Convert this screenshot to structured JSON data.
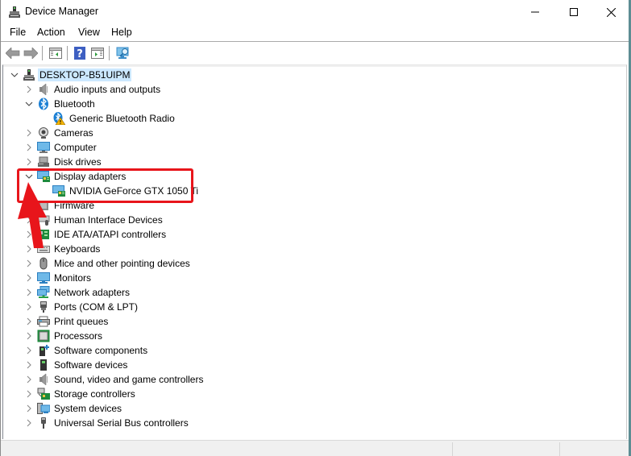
{
  "window": {
    "title": "Device Manager",
    "controls": {
      "minimize": "minimize",
      "maximize": "maximize",
      "close": "close"
    }
  },
  "menubar": {
    "items": [
      "File",
      "Action",
      "View",
      "Help"
    ]
  },
  "toolbar": {
    "buttons": [
      {
        "name": "back",
        "icon": "arrow-left-icon"
      },
      {
        "name": "forward",
        "icon": "arrow-right-icon"
      },
      {
        "name": "show-hide-console-tree",
        "icon": "console-tree-icon"
      },
      {
        "name": "help",
        "icon": "help-icon"
      },
      {
        "name": "show-action-pane",
        "icon": "action-pane-icon"
      },
      {
        "name": "scan-hardware-changes",
        "icon": "scan-monitor-icon"
      }
    ]
  },
  "tree": {
    "root": {
      "label": "DESKTOP-B51UIPM",
      "expanded": true,
      "selected": true,
      "icon": "computer-tower-icon"
    },
    "items": [
      {
        "label": "Audio inputs and outputs",
        "expanded": false,
        "icon": "speaker-icon",
        "level": 1
      },
      {
        "label": "Bluetooth",
        "expanded": true,
        "icon": "bluetooth-icon",
        "level": 1
      },
      {
        "label": "Generic Bluetooth Radio",
        "icon": "bluetooth-warning-icon",
        "level": 2,
        "warning": true
      },
      {
        "label": "Cameras",
        "expanded": false,
        "icon": "camera-icon",
        "level": 1
      },
      {
        "label": "Computer",
        "expanded": false,
        "icon": "computer-monitor-icon",
        "level": 1
      },
      {
        "label": "Disk drives",
        "expanded": false,
        "icon": "disk-drive-icon",
        "level": 1
      },
      {
        "label": "Display adapters",
        "expanded": true,
        "icon": "display-adapter-icon",
        "level": 1
      },
      {
        "label": "NVIDIA GeForce GTX 1050 Ti",
        "icon": "display-adapter-icon",
        "level": 2
      },
      {
        "label": "Firmware",
        "expanded": false,
        "icon": "firmware-icon",
        "level": 1
      },
      {
        "label": "Human Interface Devices",
        "expanded": false,
        "icon": "hid-icon",
        "level": 1
      },
      {
        "label": "IDE ATA/ATAPI controllers",
        "expanded": false,
        "icon": "ide-controller-icon",
        "level": 1
      },
      {
        "label": "Keyboards",
        "expanded": false,
        "icon": "keyboard-icon",
        "level": 1
      },
      {
        "label": "Mice and other pointing devices",
        "expanded": false,
        "icon": "mouse-icon",
        "level": 1
      },
      {
        "label": "Monitors",
        "expanded": false,
        "icon": "monitor-icon",
        "level": 1
      },
      {
        "label": "Network adapters",
        "expanded": false,
        "icon": "network-adapter-icon",
        "level": 1
      },
      {
        "label": "Ports (COM & LPT)",
        "expanded": false,
        "icon": "port-icon",
        "level": 1
      },
      {
        "label": "Print queues",
        "expanded": false,
        "icon": "printer-icon",
        "level": 1
      },
      {
        "label": "Processors",
        "expanded": false,
        "icon": "processor-icon",
        "level": 1
      },
      {
        "label": "Software components",
        "expanded": false,
        "icon": "software-component-icon",
        "level": 1
      },
      {
        "label": "Software devices",
        "expanded": false,
        "icon": "software-device-icon",
        "level": 1
      },
      {
        "label": "Sound, video and game controllers",
        "expanded": false,
        "icon": "speaker-icon",
        "level": 1
      },
      {
        "label": "Storage controllers",
        "expanded": false,
        "icon": "storage-controller-icon",
        "level": 1
      },
      {
        "label": "System devices",
        "expanded": false,
        "icon": "system-devices-icon",
        "level": 1
      },
      {
        "label": "Universal Serial Bus controllers",
        "expanded": false,
        "icon": "usb-icon",
        "level": 1
      }
    ]
  },
  "annotation": {
    "highlight_target": "Display adapters",
    "color": "#e8151b"
  },
  "colors": {
    "selection": "#cce8ff",
    "annotation_red": "#e8151b",
    "chevron": "#6b6b6b"
  }
}
